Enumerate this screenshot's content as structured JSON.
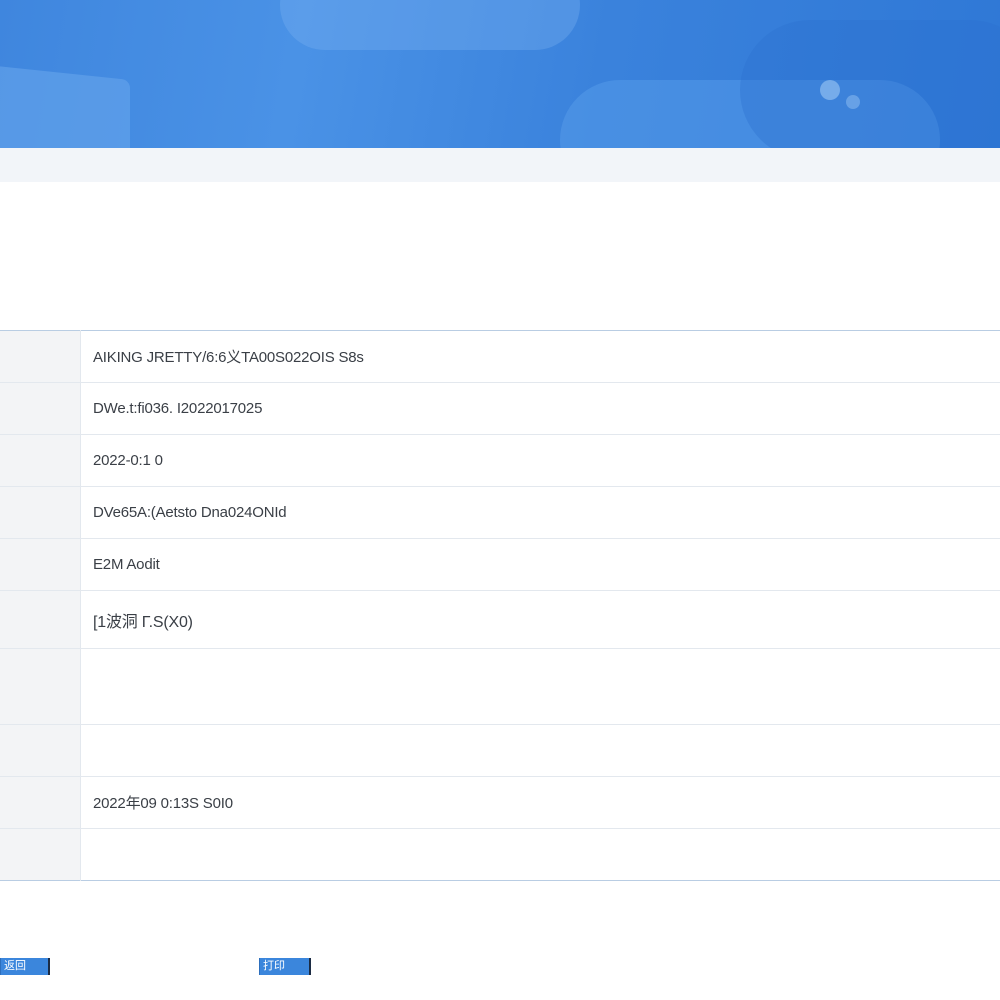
{
  "detail": {
    "rows": [
      {
        "value": "AIKING JRETTY/6:6义TA00S022OIS S8s"
      },
      {
        "value": "DWe.t:fi036. I2022017025"
      },
      {
        "value": "2022-0:1 0"
      },
      {
        "value": "DVe65A:(Aetsto Dna024ONId"
      },
      {
        "value": "E2M Aodit"
      },
      {
        "value": "[1波洞 Γ.S(X0)"
      },
      {
        "value": ""
      },
      {
        "value": ""
      },
      {
        "value": "2022年09 0:13S S0I0"
      },
      {
        "value": ""
      }
    ]
  },
  "footer": {
    "left_button_label": "返回",
    "right_button_label": "打印"
  },
  "colors": {
    "banner": "#3f86de",
    "button": "#3b86dc",
    "label_cell_bg": "#f3f4f6"
  }
}
